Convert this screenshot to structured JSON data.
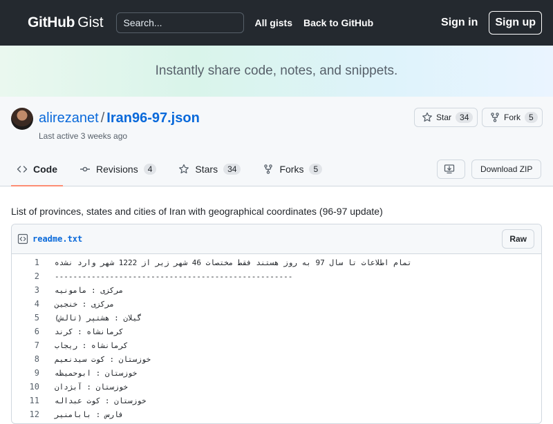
{
  "header": {
    "logo_bold": "GitHub",
    "logo_light": "Gist",
    "search_placeholder": "Search...",
    "all_gists": "All gists",
    "back_to_github": "Back to GitHub",
    "sign_in": "Sign in",
    "sign_up": "Sign up"
  },
  "hero": {
    "tagline": "Instantly share code, notes, and snippets."
  },
  "gist": {
    "owner": "alirezanet",
    "separator": "/",
    "filename_title": "Iran96-97.json",
    "last_active": "Last active 3 weeks ago",
    "star_label": "Star",
    "star_count": "34",
    "fork_label": "Fork",
    "fork_count": "5",
    "description": "List of provinces, states and cities of Iran with geographical coordinates (96-97 update)"
  },
  "tabs": [
    {
      "label": "Code",
      "count": null,
      "icon": "code-icon"
    },
    {
      "label": "Revisions",
      "count": "4",
      "icon": "commit-icon"
    },
    {
      "label": "Stars",
      "count": "34",
      "icon": "star-icon"
    },
    {
      "label": "Forks",
      "count": "5",
      "icon": "fork-icon"
    }
  ],
  "actions": {
    "download_zip": "Download ZIP",
    "embed_icon": "download-icon"
  },
  "file": {
    "name": "readme.txt",
    "raw_label": "Raw",
    "lines": [
      {
        "n": "1",
        "text": "تمام اطلاعات تا سال 97 به روز هستند فقط مختصات 46 شهر زیر از 1222 شهر وارد نشده"
      },
      {
        "n": "2",
        "text": "----------------------------------------------------"
      },
      {
        "n": "3",
        "text": "مرکزی : مامونیه"
      },
      {
        "n": "4",
        "text": "مرکزی : خنجین"
      },
      {
        "n": "5",
        "text": "گیلان : هشتپر (تالش)"
      },
      {
        "n": "6",
        "text": "کرمانشاه : کرند"
      },
      {
        "n": "7",
        "text": "کرمانشاه : ریجاب"
      },
      {
        "n": "8",
        "text": "خوزستان : کوت سیدنعیم"
      },
      {
        "n": "9",
        "text": "خوزستان : ابوحمیظه"
      },
      {
        "n": "10",
        "text": "خوزستان : آبژدان"
      },
      {
        "n": "11",
        "text": "خوزستان : کوت عبداله"
      },
      {
        "n": "12",
        "text": "فارس : بابامنیر"
      }
    ]
  }
}
